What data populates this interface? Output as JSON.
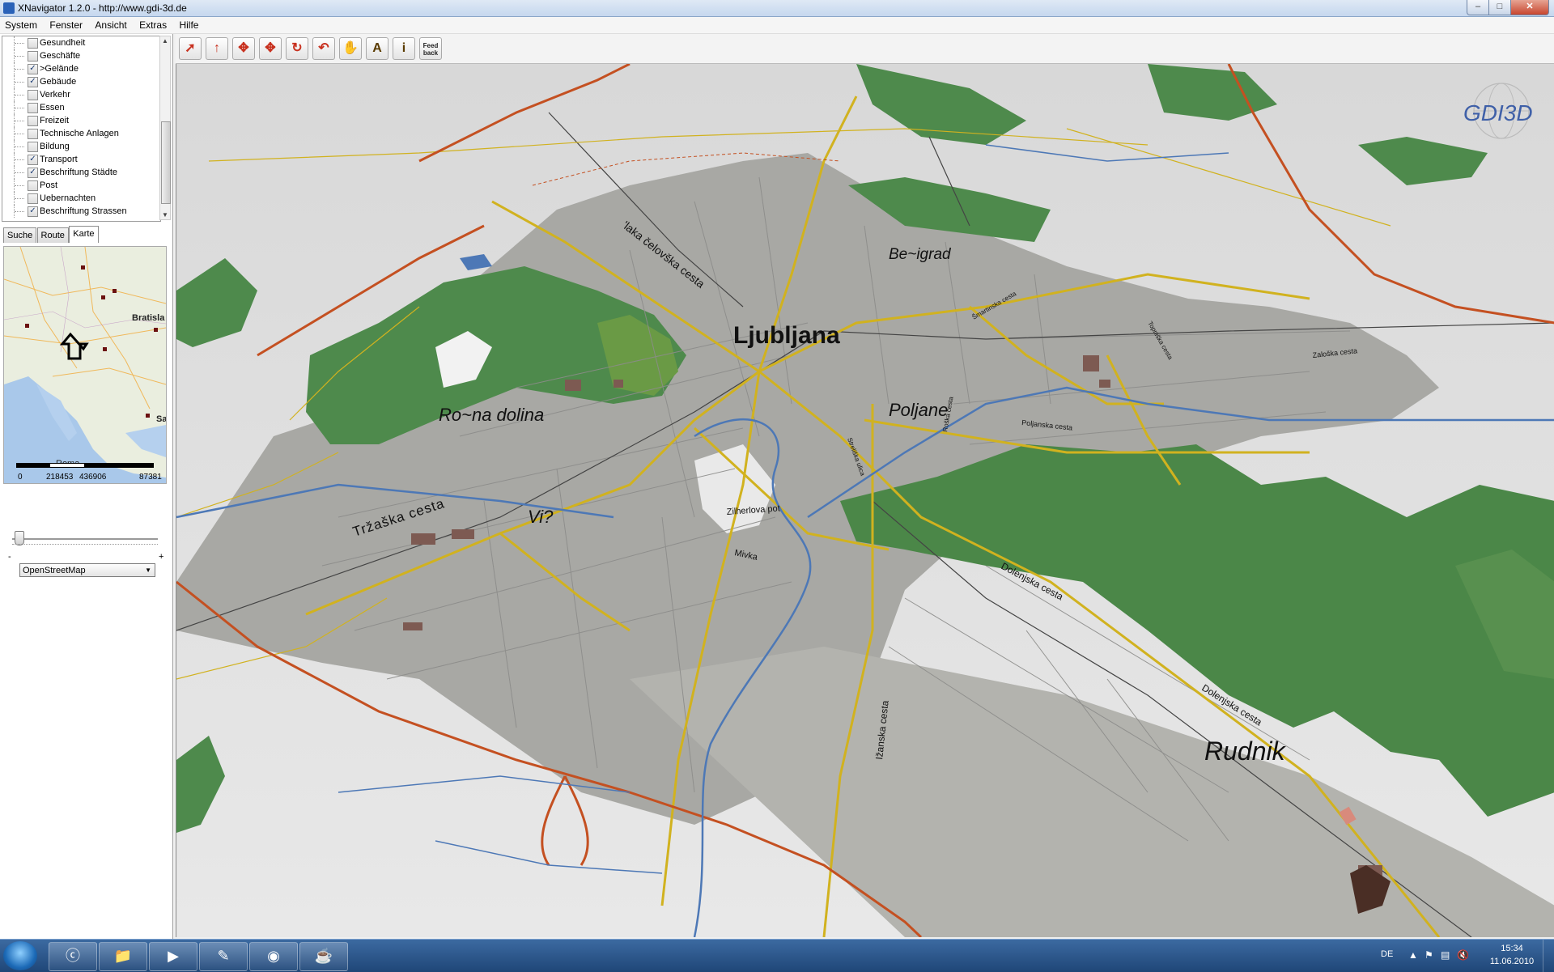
{
  "window": {
    "title": "XNavigator 1.2.0 - http://www.gdi-3d.de"
  },
  "menu": [
    "System",
    "Fenster",
    "Ansicht",
    "Extras",
    "Hilfe"
  ],
  "layers": [
    {
      "label": "Gesundheit",
      "checked": false
    },
    {
      "label": "Geschäfte",
      "checked": false
    },
    {
      "label": ">Gelände",
      "checked": true
    },
    {
      "label": "Gebäude",
      "checked": true
    },
    {
      "label": "Verkehr",
      "checked": false
    },
    {
      "label": "Essen",
      "checked": false
    },
    {
      "label": "Freizeit",
      "checked": false
    },
    {
      "label": "Technische Anlagen",
      "checked": false
    },
    {
      "label": "Bildung",
      "checked": false
    },
    {
      "label": "Transport",
      "checked": true
    },
    {
      "label": "Beschriftung Städte",
      "checked": true
    },
    {
      "label": "Post",
      "checked": false
    },
    {
      "label": "Uebernachten",
      "checked": false
    },
    {
      "label": "Beschriftung Strassen",
      "checked": true
    }
  ],
  "tabs": [
    "Suche",
    "Route",
    "Karte"
  ],
  "minimap": {
    "labels": [
      "Bratisla",
      "Sa",
      "Roma"
    ],
    "scale": [
      "0",
      "218453",
      "436906",
      "87381"
    ]
  },
  "zoom": {
    "minus": "-",
    "plus": "+"
  },
  "map_source": {
    "selected": "OpenStreetMap"
  },
  "toolbar": {
    "feedback_label": "Feed back",
    "text_tool": "A",
    "info_tool": "i"
  },
  "map": {
    "logo": "GDI3D",
    "places": [
      {
        "name": "Ljubljana",
        "id": "ljubljana"
      },
      {
        "name": "Be~igrad",
        "id": "bezigrad"
      },
      {
        "name": "Ro~na dolina",
        "id": "rozna"
      },
      {
        "name": "Poljane",
        "id": "poljane"
      },
      {
        "name": "Vi?",
        "id": "vic"
      },
      {
        "name": "Rudnik",
        "id": "rudnik"
      }
    ],
    "streets": [
      {
        "name": "Tržaška  cesta",
        "id": "trzaska"
      },
      {
        "name": "'laka  čelovška  cesta",
        "id": "celovska"
      },
      {
        "name": "Dolenjska cesta",
        "id": "dolenjska1"
      },
      {
        "name": "Dolenjska cesta",
        "id": "dolenjska2"
      },
      {
        "name": "Ižanska cesta",
        "id": "izanska"
      },
      {
        "name": "Zaloška cesta",
        "id": "zaloska"
      },
      {
        "name": "Poljanska cesta",
        "id": "poljanska"
      },
      {
        "name": "Mivka",
        "id": "mivka"
      },
      {
        "name": "Zilherlova pot",
        "id": "zilherlova"
      },
      {
        "name": "Šmartinska cesta",
        "id": "smartinska"
      },
      {
        "name": "Topniška cesta",
        "id": "topniska"
      },
      {
        "name": "Streliška ulica",
        "id": "streliska"
      },
      {
        "name": "Roška cesta",
        "id": "roska"
      }
    ]
  },
  "taskbar": {
    "language": "DE",
    "time": "15:34",
    "date": "11.06.2010"
  }
}
